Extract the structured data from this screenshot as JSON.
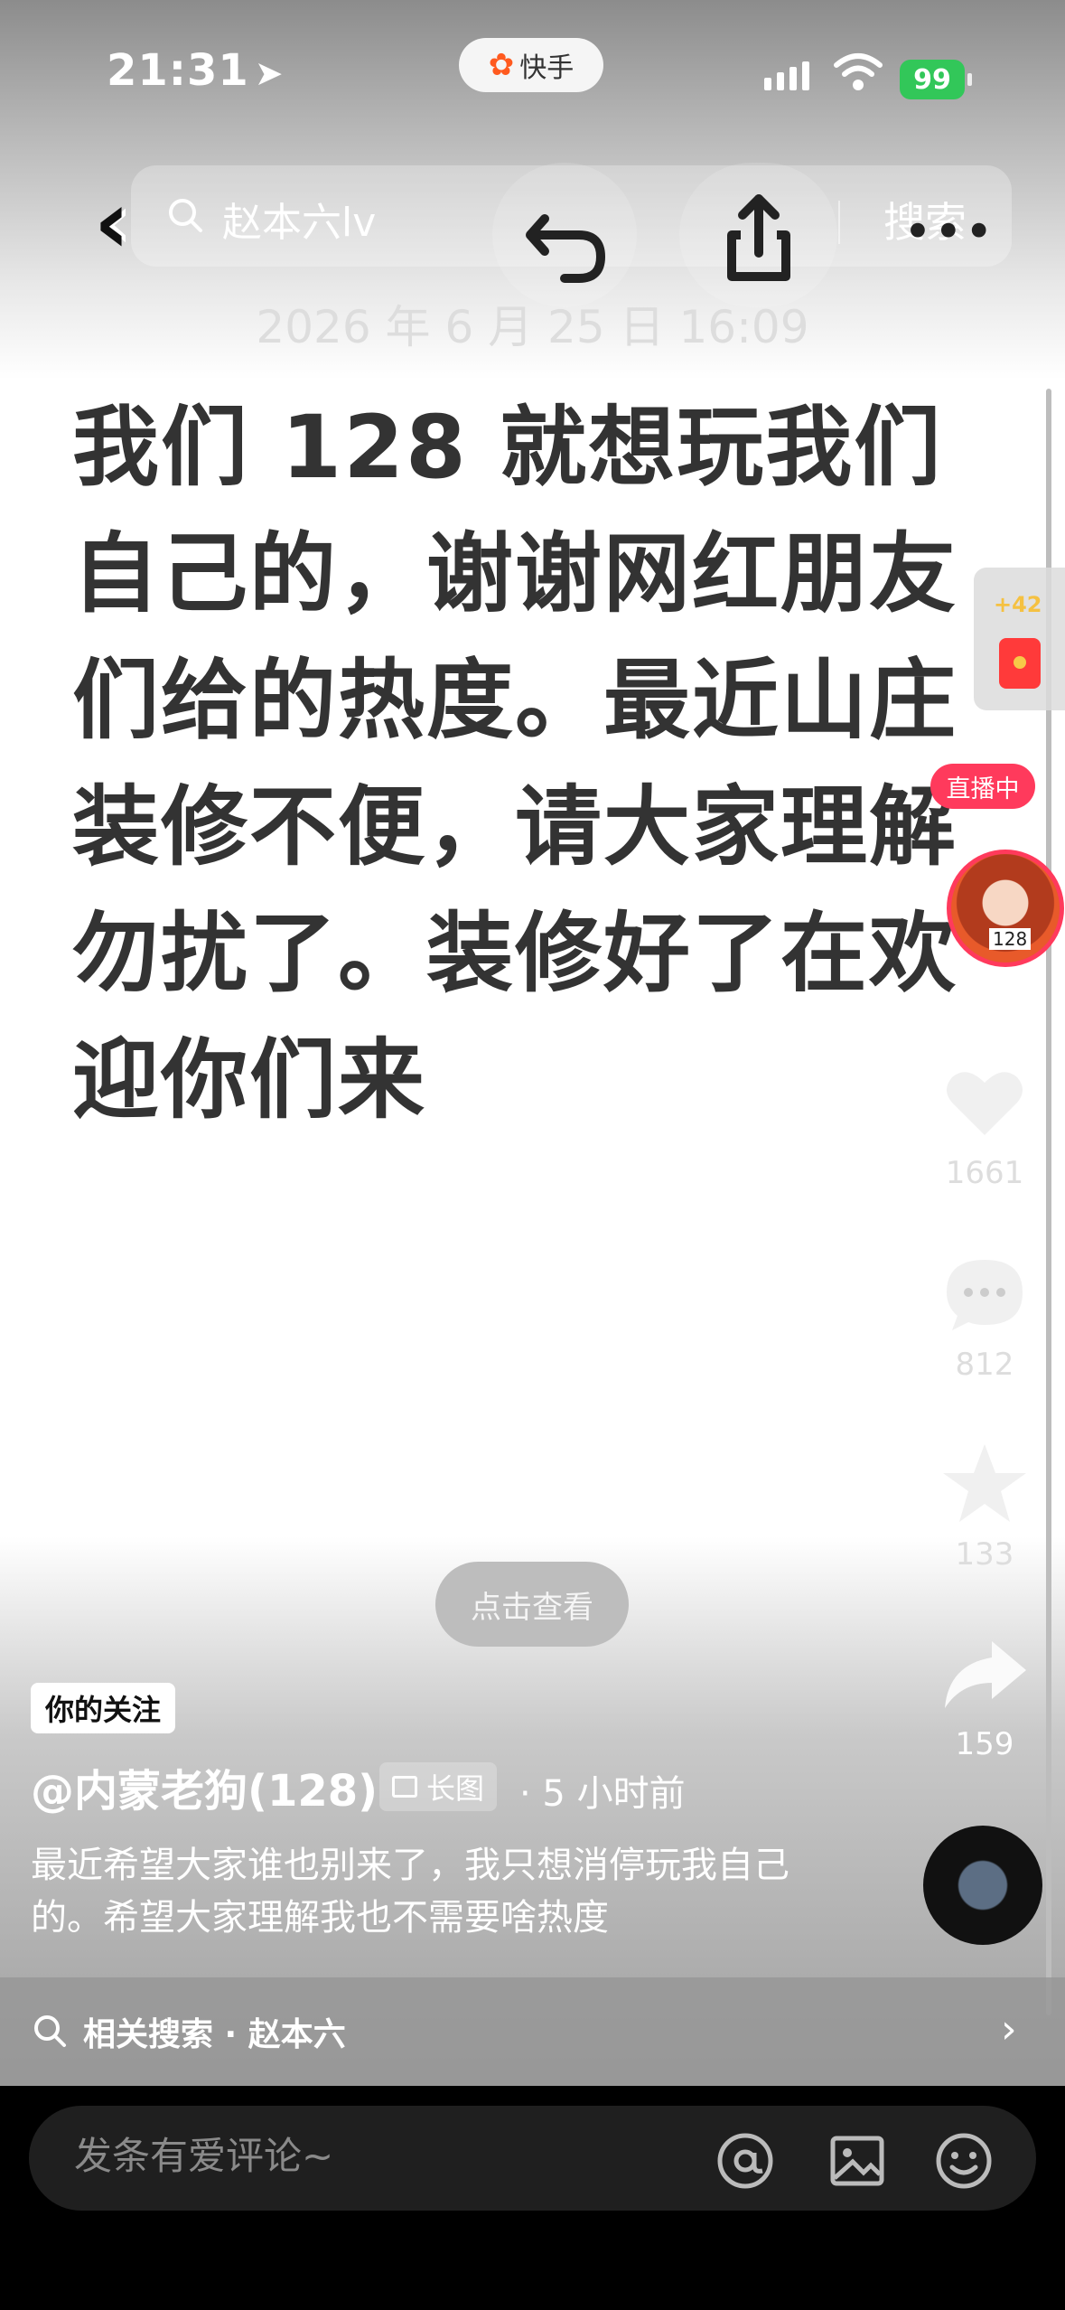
{
  "status_bar": {
    "time": "21:31",
    "app_name": "快手",
    "battery": "99"
  },
  "top_bar": {
    "search_text": "赵本六lv",
    "search_button": "搜索"
  },
  "post": {
    "date": "2026 年 6 月 25 日 16:09",
    "text": "我们 128 就想玩我们自己的，谢谢网红朋友们给的热度。最近山庄装修不便，请大家理解勿扰了。装修好了在欢迎你们来"
  },
  "side": {
    "red_packet_count": "+42",
    "live_label": "直播中",
    "likes": "1661",
    "comments": "812",
    "favorites": "133",
    "shares": "159"
  },
  "view_button": "点击查看",
  "meta": {
    "follow_tag": "你的关注",
    "author": "@内蒙老狗(128)",
    "long_pic": "长图",
    "time_ago": "· 5 小时前",
    "caption": "最近希望大家谁也别来了，我只想消停玩我自己的。希望大家理解我也不需要啥热度"
  },
  "related_search": "相关搜索 · 赵本六",
  "comment": {
    "placeholder": "发条有爱评论~"
  },
  "colors": {
    "accent_live": "#ff3a5c",
    "battery": "#32c759",
    "brand": "#ff5a1f"
  },
  "icons": [
    "back-icon",
    "search-icon",
    "undo-icon",
    "share-icon",
    "more-icon",
    "red-packet-icon",
    "heart-icon",
    "comment-icon",
    "star-icon",
    "forward-icon",
    "at-icon",
    "image-icon",
    "emoji-icon"
  ]
}
